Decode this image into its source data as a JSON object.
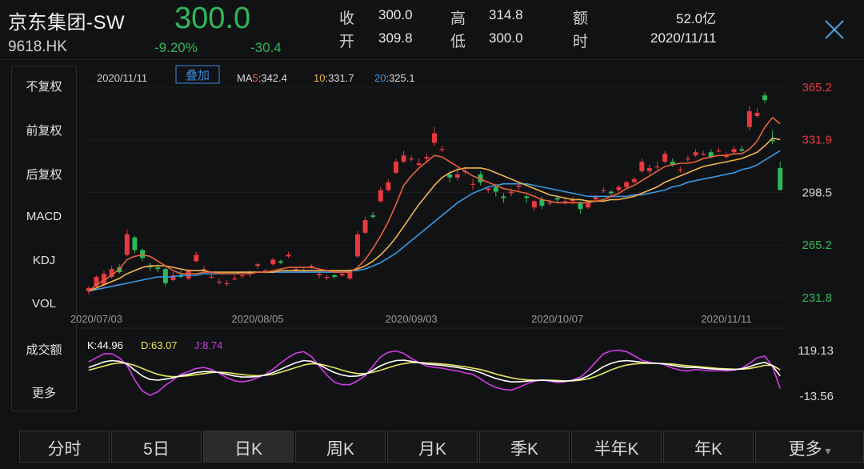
{
  "header": {
    "stock_name": "京东集团-SW",
    "stock_code": "9618.HK",
    "price": "300.0",
    "change_pct": "-9.20%",
    "change_amt": "-30.4",
    "quotes": [
      {
        "label": "收",
        "value": "300.0"
      },
      {
        "label": "高",
        "value": "314.8"
      },
      {
        "label": "额",
        "value": "52.0亿"
      },
      {
        "label": "开",
        "value": "309.8"
      },
      {
        "label": "低",
        "value": "300.0"
      },
      {
        "label": "时",
        "value": "2020/11/11"
      }
    ]
  },
  "side_menu": {
    "items": [
      "不复权",
      "前复权",
      "后复权",
      "MACD",
      "KDJ",
      "VOL",
      "成交额",
      "更多"
    ],
    "active_indices": [
      0,
      4
    ]
  },
  "legend": {
    "date": "2020/11/11",
    "overlay_button": "叠加",
    "ma5_prefix": "MA",
    "ma5_num": "5",
    "ma5_value": ":342.4",
    "ma10_num": "10",
    "ma10_value": ":331.7",
    "ma20_num": "20",
    "ma20_value": ":325.1",
    "kdj_k": "K:44.96",
    "kdj_d": "D:63.07",
    "kdj_j": "J:8.74"
  },
  "tabs": {
    "items": [
      "分时",
      "5日",
      "日K",
      "周K",
      "月K",
      "季K",
      "半年K",
      "年K",
      "更多"
    ],
    "active_index": 2,
    "more_arrow": "▾"
  },
  "colors": {
    "up": "#e8393f",
    "down": "#2fb85a",
    "ma5": "#e8633a",
    "ma10": "#f2b64a",
    "ma20": "#3a9ae6",
    "kdj_k": "#ffffff",
    "kdj_d": "#e8e85a",
    "kdj_j": "#d23ce6",
    "accent": "#4a8ef0"
  },
  "chart_data": {
    "type": "candlestick",
    "title": "",
    "y_ticks": [
      {
        "label": "365.2",
        "value": 365.2,
        "color": "up"
      },
      {
        "label": "331.9",
        "value": 331.9,
        "color": "up"
      },
      {
        "label": "298.5",
        "value": 298.5,
        "color": "neutral"
      },
      {
        "label": "265.2",
        "value": 265.2,
        "color": "down"
      },
      {
        "label": "231.8",
        "value": 231.8,
        "color": "down"
      }
    ],
    "ylim": [
      231.8,
      365.2
    ],
    "x_ticks": [
      {
        "label": "2020/07/03",
        "index": 1
      },
      {
        "label": "2020/08/05",
        "index": 22
      },
      {
        "label": "2020/09/03",
        "index": 42
      },
      {
        "label": "2020/10/07",
        "index": 61
      },
      {
        "label": "2020/11/11",
        "index": 83
      }
    ],
    "candles": [
      {
        "o": 236,
        "c": 238,
        "h": 239,
        "l": 234
      },
      {
        "o": 239,
        "c": 245,
        "h": 246,
        "l": 238
      },
      {
        "o": 240,
        "c": 247,
        "h": 249,
        "l": 239
      },
      {
        "o": 245,
        "c": 250,
        "h": 252,
        "l": 244
      },
      {
        "o": 251,
        "c": 248,
        "h": 253,
        "l": 247
      },
      {
        "o": 259,
        "c": 272,
        "h": 275,
        "l": 258
      },
      {
        "o": 270,
        "c": 262,
        "h": 271,
        "l": 260
      },
      {
        "o": 262,
        "c": 257,
        "h": 263,
        "l": 255
      },
      {
        "o": 252,
        "c": 251,
        "h": 254,
        "l": 249
      },
      {
        "o": 251,
        "c": 250,
        "h": 253,
        "l": 248
      },
      {
        "o": 250,
        "c": 241,
        "h": 251,
        "l": 239
      },
      {
        "o": 243,
        "c": 246,
        "h": 248,
        "l": 242
      },
      {
        "o": 246,
        "c": 245,
        "h": 249,
        "l": 244
      },
      {
        "o": 244,
        "c": 249,
        "h": 250,
        "l": 243
      },
      {
        "o": 255,
        "c": 259,
        "h": 261,
        "l": 254
      },
      {
        "o": 250,
        "c": 250,
        "h": 252,
        "l": 248
      },
      {
        "o": 245,
        "c": 245,
        "h": 247,
        "l": 244
      },
      {
        "o": 242,
        "c": 242,
        "h": 244,
        "l": 240
      },
      {
        "o": 241,
        "c": 241,
        "h": 243,
        "l": 239
      },
      {
        "o": 244,
        "c": 244,
        "h": 246,
        "l": 243
      },
      {
        "o": 246,
        "c": 246,
        "h": 247,
        "l": 244
      },
      {
        "o": 247,
        "c": 248,
        "h": 249,
        "l": 245
      },
      {
        "o": 252,
        "c": 253,
        "h": 254,
        "l": 250
      },
      {
        "o": 249,
        "c": 249,
        "h": 250,
        "l": 247
      },
      {
        "o": 253,
        "c": 256,
        "h": 257,
        "l": 252
      },
      {
        "o": 255,
        "c": 254,
        "h": 256,
        "l": 253
      },
      {
        "o": 258,
        "c": 259,
        "h": 261,
        "l": 257
      },
      {
        "o": 250,
        "c": 250,
        "h": 251,
        "l": 248
      },
      {
        "o": 249,
        "c": 249,
        "h": 251,
        "l": 248
      },
      {
        "o": 251,
        "c": 252,
        "h": 253,
        "l": 250
      },
      {
        "o": 246,
        "c": 247,
        "h": 249,
        "l": 244
      },
      {
        "o": 245,
        "c": 245,
        "h": 246,
        "l": 243
      },
      {
        "o": 246,
        "c": 245,
        "h": 247,
        "l": 244
      },
      {
        "o": 246,
        "c": 247,
        "h": 248,
        "l": 245
      },
      {
        "o": 244,
        "c": 249,
        "h": 250,
        "l": 243
      },
      {
        "o": 258,
        "c": 272,
        "h": 274,
        "l": 257
      },
      {
        "o": 273,
        "c": 281,
        "h": 283,
        "l": 272
      },
      {
        "o": 284,
        "c": 283,
        "h": 286,
        "l": 282
      },
      {
        "o": 293,
        "c": 300,
        "h": 302,
        "l": 292
      },
      {
        "o": 300,
        "c": 305,
        "h": 307,
        "l": 299
      },
      {
        "o": 311,
        "c": 318,
        "h": 320,
        "l": 310
      },
      {
        "o": 318,
        "c": 322,
        "h": 325,
        "l": 317
      },
      {
        "o": 320,
        "c": 320,
        "h": 322,
        "l": 318
      },
      {
        "o": 316,
        "c": 317,
        "h": 320,
        "l": 315
      },
      {
        "o": 320,
        "c": 321,
        "h": 323,
        "l": 318
      },
      {
        "o": 330,
        "c": 336,
        "h": 340,
        "l": 328
      },
      {
        "o": 326,
        "c": 326,
        "h": 328,
        "l": 324
      },
      {
        "o": 310,
        "c": 308,
        "h": 312,
        "l": 305
      },
      {
        "o": 308,
        "c": 310,
        "h": 314,
        "l": 306
      },
      {
        "o": 312,
        "c": 312,
        "h": 315,
        "l": 310
      },
      {
        "o": 304,
        "c": 304,
        "h": 307,
        "l": 300
      },
      {
        "o": 310,
        "c": 305,
        "h": 312,
        "l": 303
      },
      {
        "o": 300,
        "c": 301,
        "h": 302,
        "l": 298
      },
      {
        "o": 302,
        "c": 299,
        "h": 304,
        "l": 296
      },
      {
        "o": 296,
        "c": 295,
        "h": 298,
        "l": 292
      },
      {
        "o": 298,
        "c": 299,
        "h": 301,
        "l": 296
      },
      {
        "o": 302,
        "c": 303,
        "h": 304,
        "l": 300
      },
      {
        "o": 296,
        "c": 295,
        "h": 297,
        "l": 292
      },
      {
        "o": 289,
        "c": 293,
        "h": 294,
        "l": 287
      },
      {
        "o": 294,
        "c": 290,
        "h": 296,
        "l": 288
      },
      {
        "o": 292,
        "c": 292,
        "h": 294,
        "l": 290
      },
      {
        "o": 295,
        "c": 294,
        "h": 296,
        "l": 292
      },
      {
        "o": 293,
        "c": 293,
        "h": 295,
        "l": 291
      },
      {
        "o": 293,
        "c": 294,
        "h": 296,
        "l": 291
      },
      {
        "o": 292,
        "c": 288,
        "h": 293,
        "l": 285
      },
      {
        "o": 289,
        "c": 292,
        "h": 293,
        "l": 288
      },
      {
        "o": 294,
        "c": 296,
        "h": 297,
        "l": 292
      },
      {
        "o": 300,
        "c": 300,
        "h": 302,
        "l": 298
      },
      {
        "o": 299,
        "c": 298,
        "h": 300,
        "l": 296
      },
      {
        "o": 300,
        "c": 302,
        "h": 303,
        "l": 299
      },
      {
        "o": 302,
        "c": 305,
        "h": 306,
        "l": 301
      },
      {
        "o": 305,
        "c": 307,
        "h": 308,
        "l": 304
      },
      {
        "o": 312,
        "c": 318,
        "h": 320,
        "l": 311
      },
      {
        "o": 312,
        "c": 314,
        "h": 316,
        "l": 310
      },
      {
        "o": 315,
        "c": 315,
        "h": 318,
        "l": 313
      },
      {
        "o": 318,
        "c": 323,
        "h": 325,
        "l": 317
      },
      {
        "o": 318,
        "c": 316,
        "h": 320,
        "l": 315
      },
      {
        "o": 313,
        "c": 313,
        "h": 315,
        "l": 311
      },
      {
        "o": 320,
        "c": 320,
        "h": 322,
        "l": 318
      },
      {
        "o": 322,
        "c": 324,
        "h": 326,
        "l": 321
      },
      {
        "o": 323,
        "c": 323,
        "h": 325,
        "l": 322
      },
      {
        "o": 324,
        "c": 321,
        "h": 326,
        "l": 320
      },
      {
        "o": 325,
        "c": 325,
        "h": 327,
        "l": 324
      },
      {
        "o": 321,
        "c": 322,
        "h": 324,
        "l": 320
      },
      {
        "o": 324,
        "c": 326,
        "h": 328,
        "l": 323
      },
      {
        "o": 326,
        "c": 325,
        "h": 328,
        "l": 324
      },
      {
        "o": 340,
        "c": 350,
        "h": 353,
        "l": 338
      },
      {
        "o": 347,
        "c": 349,
        "h": 352,
        "l": 346
      },
      {
        "o": 360,
        "c": 357,
        "h": 362,
        "l": 355
      },
      {
        "o": 332,
        "c": 331,
        "h": 338,
        "l": 329
      },
      {
        "o": 314,
        "c": 300,
        "h": 318,
        "l": 300
      }
    ],
    "ma5": [
      236,
      240,
      243,
      246,
      250,
      256,
      258,
      259,
      258,
      255,
      252,
      249,
      247,
      247,
      247,
      248,
      248,
      247,
      247,
      247,
      247,
      247,
      248,
      248,
      249,
      250,
      251,
      251,
      251,
      251,
      250,
      249,
      248,
      248,
      248,
      251,
      256,
      263,
      271,
      280,
      291,
      303,
      309,
      314,
      318,
      322,
      321,
      318,
      315,
      312,
      309,
      307,
      305,
      303,
      301,
      300,
      299,
      298,
      296,
      294,
      293,
      292,
      292,
      292,
      292,
      292,
      293,
      294,
      296,
      298,
      301,
      303,
      306,
      309,
      312,
      315,
      316,
      317,
      317,
      318,
      320,
      321,
      322,
      322,
      323,
      323,
      326,
      331,
      340,
      346,
      342
    ],
    "ma10": [
      236,
      238,
      240,
      242,
      244,
      247,
      249,
      251,
      252,
      252,
      252,
      251,
      250,
      249,
      249,
      249,
      248,
      248,
      248,
      248,
      248,
      248,
      248,
      248,
      248,
      249,
      249,
      249,
      249,
      249,
      249,
      249,
      249,
      249,
      249,
      250,
      252,
      255,
      259,
      264,
      270,
      277,
      284,
      291,
      297,
      303,
      308,
      311,
      313,
      314,
      314,
      314,
      313,
      311,
      309,
      307,
      305,
      303,
      301,
      299,
      297,
      296,
      295,
      294,
      294,
      293,
      293,
      293,
      294,
      294,
      295,
      296,
      298,
      300,
      302,
      305,
      307,
      309,
      311,
      313,
      315,
      316,
      317,
      318,
      319,
      320,
      322,
      324,
      328,
      333,
      332
    ],
    "ma20": [
      236,
      237,
      238,
      239,
      240,
      241,
      242,
      243,
      244,
      245,
      245,
      245,
      246,
      246,
      246,
      247,
      247,
      247,
      247,
      247,
      248,
      248,
      248,
      248,
      248,
      248,
      248,
      248,
      248,
      248,
      248,
      248,
      248,
      248,
      249,
      249,
      250,
      252,
      254,
      257,
      260,
      264,
      268,
      272,
      276,
      280,
      284,
      288,
      292,
      295,
      298,
      300,
      302,
      303,
      304,
      304,
      304,
      304,
      303,
      302,
      301,
      300,
      299,
      298,
      297,
      296,
      296,
      296,
      296,
      296,
      296,
      297,
      297,
      298,
      299,
      300,
      302,
      303,
      305,
      306,
      307,
      308,
      309,
      310,
      311,
      313,
      314,
      316,
      319,
      322,
      325
    ],
    "kdj": {
      "ylim": [
        -13.56,
        119.13
      ],
      "y_ticks": [
        {
          "label": "119.13",
          "value": 119.13
        },
        {
          "label": "-13.56",
          "value": -13.56
        }
      ],
      "k": [
        70,
        78,
        86,
        90,
        88,
        80,
        62,
        45,
        35,
        33,
        36,
        40,
        46,
        50,
        55,
        58,
        58,
        55,
        50,
        45,
        42,
        42,
        44,
        48,
        55,
        65,
        75,
        84,
        90,
        88,
        78,
        66,
        55,
        48,
        44,
        45,
        50,
        62,
        75,
        84,
        90,
        91,
        88,
        84,
        80,
        78,
        76,
        73,
        70,
        66,
        62,
        55,
        46,
        38,
        32,
        28,
        28,
        30,
        32,
        33,
        32,
        30,
        30,
        32,
        36,
        45,
        58,
        72,
        82,
        88,
        90,
        88,
        85,
        83,
        82,
        80,
        76,
        72,
        70,
        70,
        68,
        66,
        65,
        64,
        64,
        66,
        72,
        80,
        85,
        75,
        45
      ],
      "d": [
        62,
        68,
        74,
        80,
        83,
        82,
        76,
        67,
        58,
        50,
        45,
        43,
        44,
        46,
        49,
        52,
        55,
        56,
        55,
        52,
        49,
        47,
        46,
        47,
        50,
        56,
        63,
        70,
        77,
        81,
        80,
        75,
        69,
        62,
        56,
        52,
        52,
        56,
        62,
        69,
        76,
        81,
        84,
        84,
        83,
        82,
        80,
        78,
        75,
        72,
        68,
        64,
        58,
        51,
        45,
        40,
        36,
        34,
        33,
        33,
        33,
        32,
        31,
        31,
        33,
        37,
        44,
        53,
        63,
        71,
        77,
        80,
        82,
        82,
        82,
        81,
        80,
        77,
        75,
        73,
        71,
        69,
        67,
        66,
        65,
        65,
        67,
        71,
        76,
        76,
        63
      ],
      "j": [
        86,
        98,
        110,
        110,
        98,
        76,
        34,
        1,
        -11,
        -1,
        18,
        34,
        50,
        58,
        67,
        70,
        64,
        53,
        40,
        31,
        28,
        32,
        40,
        50,
        65,
        83,
        99,
        112,
        116,
        102,
        74,
        48,
        27,
        20,
        20,
        31,
        46,
        74,
        101,
        114,
        118,
        111,
        96,
        84,
        74,
        70,
        68,
        63,
        60,
        54,
        50,
        37,
        22,
        12,
        6,
        4,
        12,
        22,
        30,
        33,
        30,
        26,
        28,
        34,
        42,
        61,
        86,
        110,
        118,
        120,
        116,
        104,
        91,
        85,
        82,
        78,
        68,
        62,
        60,
        64,
        62,
        60,
        61,
        60,
        62,
        68,
        82,
        98,
        103,
        73,
        8.74
      ]
    }
  }
}
